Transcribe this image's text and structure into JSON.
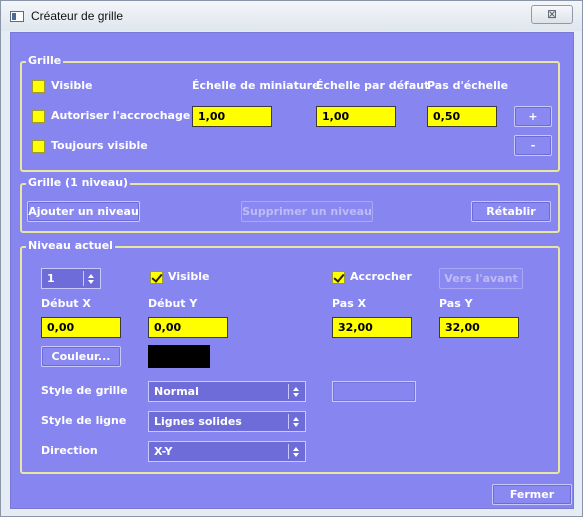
{
  "window": {
    "title": "Créateur de grille",
    "close_glyph": "⊠"
  },
  "grille": {
    "legend": "Grille",
    "visible_label": "Visible",
    "snap_label": "Autoriser l'accrochage",
    "always_visible_label": "Toujours visible",
    "thumb_scale_label": "Échelle de miniature",
    "default_scale_label": "Échelle par défaut",
    "scale_step_label": "Pas d'échelle",
    "thumb_scale_value": "1,00",
    "default_scale_value": "1,00",
    "scale_step_value": "0,50",
    "plus_label": "+",
    "minus_label": "-"
  },
  "levels": {
    "legend": "Grille (1 niveau)",
    "add_label": "Ajouter un niveau",
    "remove_label": "Supprimer un niveau",
    "reset_label": "Rétablir"
  },
  "current": {
    "legend": "Niveau actuel",
    "level_value": "1",
    "visible_label": "Visible",
    "snap_label": "Accrocher",
    "forward_label": "Vers l'avant",
    "start_x_label": "Début X",
    "start_y_label": "Début Y",
    "step_x_label": "Pas X",
    "step_y_label": "Pas Y",
    "start_x_value": "0,00",
    "start_y_value": "0,00",
    "step_x_value": "32,00",
    "step_y_value": "32,00",
    "color_label": "Couleur...",
    "color_value": "#000000",
    "grid_style_label": "Style de grille",
    "grid_style_value": "Normal",
    "line_style_label": "Style de ligne",
    "line_style_value": "Lignes solides",
    "direction_label": "Direction",
    "direction_value": "X-Y"
  },
  "footer": {
    "close_label": "Fermer"
  },
  "colors": {
    "panel": "#8786f0",
    "field": "#ffff00",
    "border": "#e8e6a2"
  }
}
